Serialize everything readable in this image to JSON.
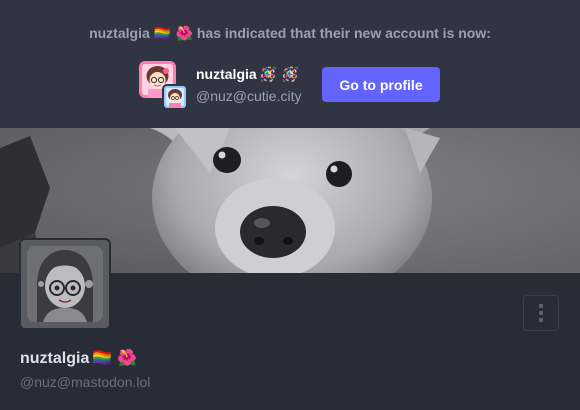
{
  "moved_notice": {
    "name": "nuztalgia",
    "name_emoji": "🏳️‍🌈 🌺",
    "text": "has indicated that their new account is now:"
  },
  "target_account": {
    "display_name": "nuztalgia",
    "name_emoji": "🪅 🪅",
    "handle": "@nuz@cutie.city",
    "go_to_profile_label": "Go to profile"
  },
  "profile": {
    "display_name": "nuztalgia",
    "name_emoji": "🏳️‍🌈 🌺",
    "handle": "@nuz@mastodon.lol"
  },
  "icons": {
    "menu": "vertical-ellipsis-icon",
    "avatar": "cartoon-avatar-icon",
    "header": "dog-photo"
  },
  "colors": {
    "accent": "#6364ff",
    "background": "#282c37",
    "banner": "#313543"
  }
}
